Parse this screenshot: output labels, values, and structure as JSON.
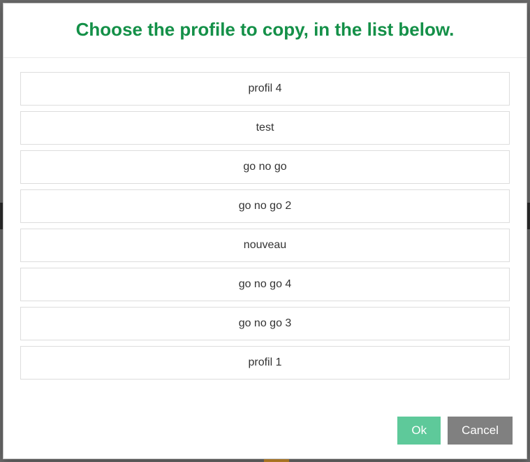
{
  "dialog": {
    "title": "Choose the profile to copy, in the list below.",
    "profiles": [
      {
        "label": "profil 4"
      },
      {
        "label": "test"
      },
      {
        "label": "go no go"
      },
      {
        "label": "go no go 2"
      },
      {
        "label": "nouveau"
      },
      {
        "label": "go no go 4"
      },
      {
        "label": "go no go 3"
      },
      {
        "label": "profil 1"
      }
    ],
    "buttons": {
      "ok": "Ok",
      "cancel": "Cancel"
    }
  }
}
